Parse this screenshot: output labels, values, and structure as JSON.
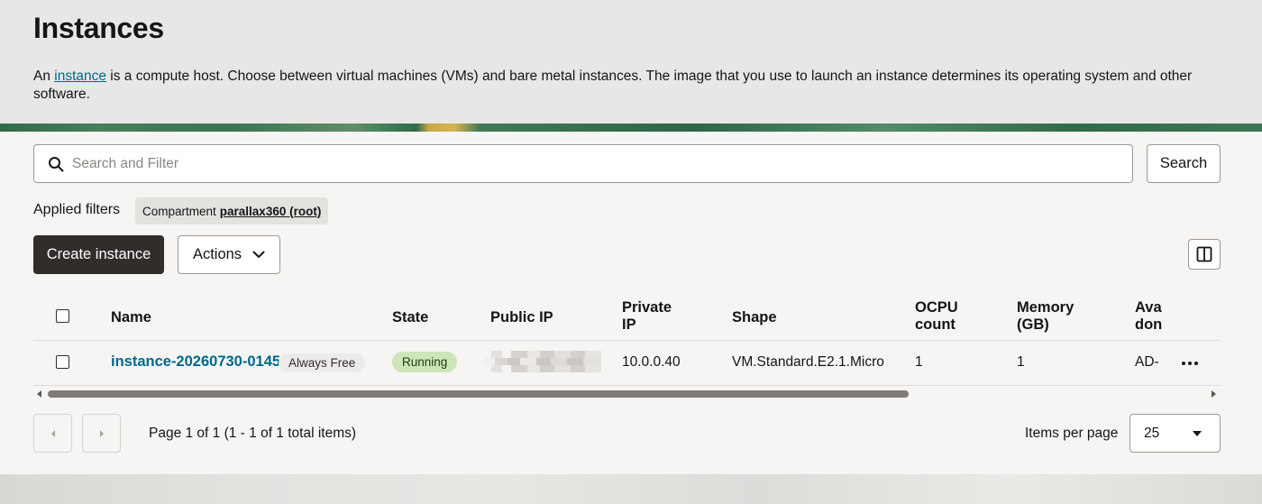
{
  "page": {
    "title": "Instances",
    "intro_prefix": "An ",
    "intro_link": "instance",
    "intro_suffix": " is a compute host. Choose between virtual machines (VMs) and bare metal instances. The image that you use to launch an instance determines its operating system and other software."
  },
  "search": {
    "placeholder": "Search and Filter",
    "value": "",
    "button_label": "Search"
  },
  "filters": {
    "label": "Applied filters",
    "chips": [
      {
        "key": "Compartment",
        "value": "parallax360 (root)"
      }
    ]
  },
  "toolbar": {
    "create_label": "Create instance",
    "actions_label": "Actions"
  },
  "table": {
    "headers": {
      "name": "Name",
      "state": "State",
      "public_ip": "Public IP",
      "private_ip_1": "Private",
      "private_ip_2": "IP",
      "shape": "Shape",
      "ocpu_1": "OCPU",
      "ocpu_2": "count",
      "memory_1": "Memory",
      "memory_2": "(GB)",
      "avail_1": "Ava",
      "avail_2": "don"
    },
    "rows": [
      {
        "name": "instance-20260730-0145",
        "badge": "Always Free",
        "state": "Running",
        "public_ip": "",
        "private_ip": "10.0.0.40",
        "shape": "VM.Standard.E2.1.Micro",
        "ocpu": "1",
        "memory": "1",
        "availability": "AD-"
      }
    ]
  },
  "pagination": {
    "info": "Page 1 of 1 (1 - 1 of 1 total items)",
    "items_per_page_label": "Items per page",
    "items_per_page_value": "25"
  },
  "colors": {
    "primary_button": "#312d2a",
    "link": "#00688c",
    "running_badge": "#cde5b9"
  }
}
